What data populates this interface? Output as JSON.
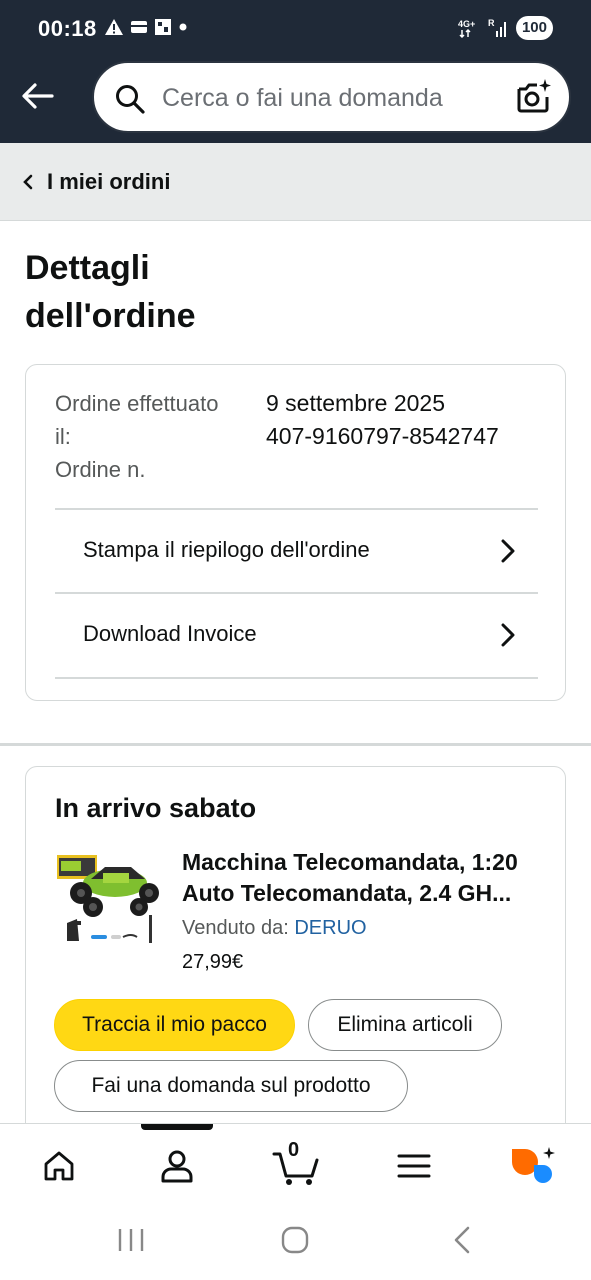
{
  "status_bar": {
    "time": "00:18",
    "network": "4G+",
    "battery": "100"
  },
  "search": {
    "placeholder": "Cerca o fai una domanda"
  },
  "breadcrumb": {
    "label": "I miei ordini"
  },
  "page": {
    "title": "Dettagli dell'ordine"
  },
  "order_info": {
    "placed_label": "Ordine effettuato il:",
    "number_label": "Ordine n.",
    "placed_value": "9 settembre 2025",
    "number_value": "407-9160797-8542747"
  },
  "actions": {
    "print_summary": "Stampa il riepilogo dell'ordine",
    "download_invoice": "Download Invoice"
  },
  "shipment": {
    "title": "In arrivo sabato",
    "product_name": "Macchina Telecomandata, 1:20 Auto Telecomandata, 2.4 GH...",
    "seller_label": "Venduto da:",
    "seller_name": "DERUO",
    "price": "27,99€",
    "track_button": "Traccia il mio pacco",
    "remove_button": "Elimina articoli",
    "ask_button": "Fai una domanda sul prodotto"
  },
  "bottom_nav": {
    "cart_count": "0",
    "items": [
      "home-icon",
      "account-icon",
      "cart-icon",
      "menu-icon",
      "rufus-icon"
    ]
  },
  "colors": {
    "header_bg": "#1f2937",
    "primary_button": "#ffd814",
    "link": "#2162a1",
    "rufus_orange": "#ff6b00",
    "rufus_blue": "#1a8cff"
  }
}
